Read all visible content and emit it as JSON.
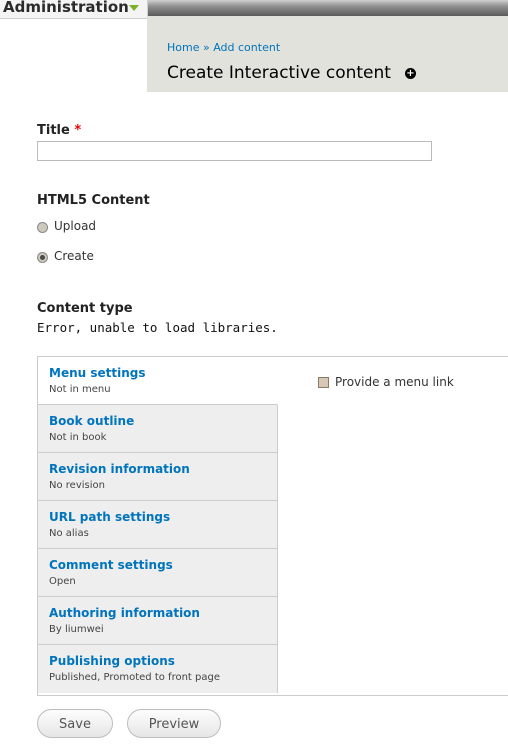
{
  "adminbar": {
    "title": "Administration"
  },
  "breadcrumb": {
    "home": "Home",
    "separator": "»",
    "add_content": "Add content"
  },
  "page": {
    "title": "Create Interactive content"
  },
  "form": {
    "title_label": "Title",
    "required_mark": "*",
    "title_value": "",
    "html5_label": "HTML5 Content",
    "radio_upload": "Upload",
    "radio_create": "Create",
    "radio_selected": "Create",
    "content_type_label": "Content type",
    "error_message": "Error, unable to load libraries."
  },
  "vtabs": [
    {
      "title": "Menu settings",
      "summary": "Not in menu"
    },
    {
      "title": "Book outline",
      "summary": "Not in book"
    },
    {
      "title": "Revision information",
      "summary": "No revision"
    },
    {
      "title": "URL path settings",
      "summary": "No alias"
    },
    {
      "title": "Comment settings",
      "summary": "Open"
    },
    {
      "title": "Authoring information",
      "summary": "By liumwei"
    },
    {
      "title": "Publishing options",
      "summary": "Published, Promoted to front page"
    }
  ],
  "menu_pane": {
    "checkbox_label": "Provide a menu link",
    "checked": false
  },
  "buttons": {
    "save": "Save",
    "preview": "Preview"
  },
  "colors": {
    "link": "#0074bd",
    "header_bg": "#e1e2dc",
    "required": "#e00000"
  }
}
